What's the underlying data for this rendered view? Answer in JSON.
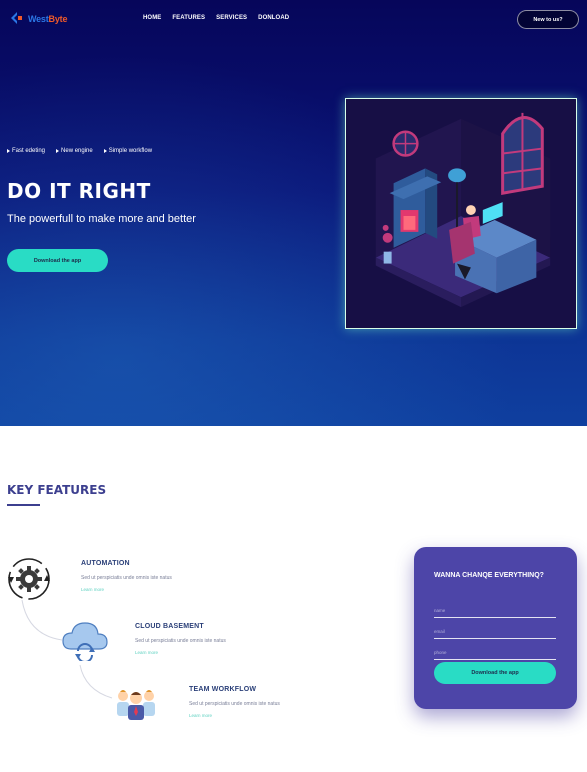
{
  "brand": {
    "logo_part1": "West",
    "logo_part2": "Byte"
  },
  "nav": {
    "items": [
      "HOME",
      "FEATURES",
      "SERVICES",
      "DONLOAD"
    ],
    "cta": "New to us?"
  },
  "hero": {
    "features": [
      "Fast edeting",
      "New engine",
      "Simple workflow"
    ],
    "title": "DO IT RIGHT",
    "subtitle": "The powerfull to make more and better",
    "button": "Download the app",
    "art_icon": "isometric-room-illustration"
  },
  "key_features": {
    "title": "KEY FEATURES",
    "items": [
      {
        "title": "AUTOMATION",
        "desc": "Sed ut perspiciatis unde omnis iste natus",
        "link": "Learn more",
        "icon": "gear-icon"
      },
      {
        "title": "CLOUD BASEMENT",
        "desc": "Sed ut perspiciatis unde omnis iste natus",
        "link": "Learn more",
        "icon": "cloud-sync-icon"
      },
      {
        "title": "TEAM WORKFLOW",
        "desc": "Sed ut perspiciatis unde omnis iste natus",
        "link": "Learn more",
        "icon": "team-icon"
      }
    ]
  },
  "form": {
    "title": "WANNA CHANQE EVERYTHINQ?",
    "fields": [
      {
        "placeholder": "name",
        "value": ""
      },
      {
        "placeholder": "email",
        "value": ""
      },
      {
        "placeholder": "phone",
        "value": ""
      }
    ],
    "button": "Download the app"
  },
  "colors": {
    "accent": "#29dcc5",
    "hero_bg": "#06065a",
    "card_bg": "#4d45a8",
    "heading": "#3c3f8f"
  }
}
